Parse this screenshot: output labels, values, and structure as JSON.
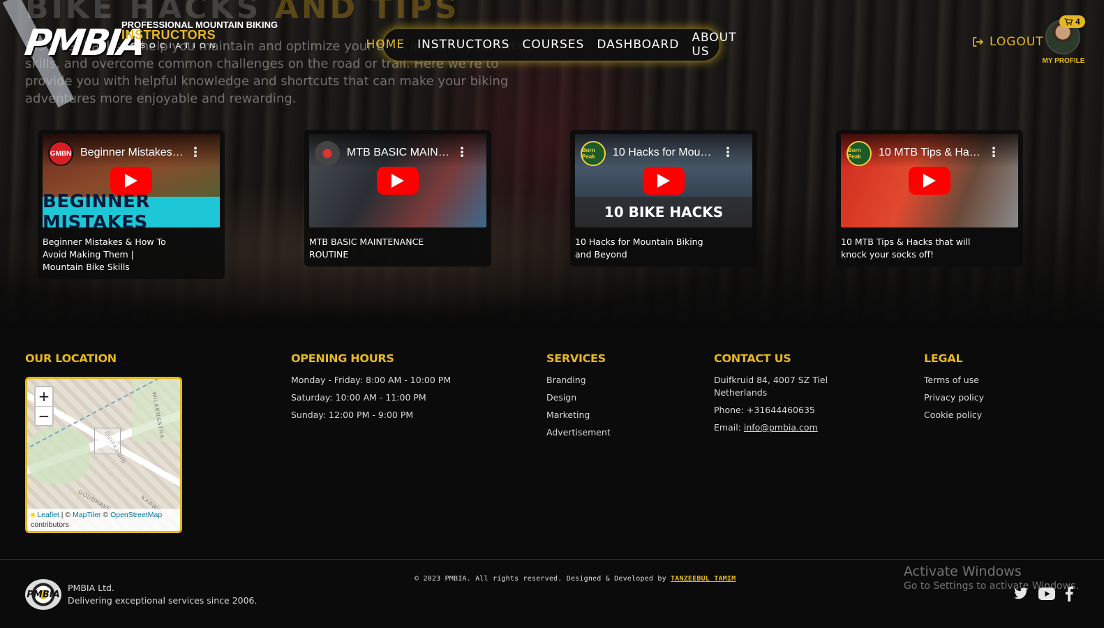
{
  "hero": {
    "title_main": "BIKE HACKS",
    "title_accent": "AND TIPS",
    "description": "Discover hacks to help you maintain and optimize your bike, improve your riding skills, and overcome common challenges on the road or trail. Here we're to provide you with helpful knowledge and shortcuts that can make your biking adventures more enjoyable and rewarding."
  },
  "logo": {
    "mark": "PMBIA",
    "line1": "PROFESSIONAL MOUNTAIN BIKING",
    "line2": "INSTRUCTORS",
    "line3": "ASSOCIATION"
  },
  "nav": {
    "items": [
      {
        "label": "HOME",
        "active": true
      },
      {
        "label": "INSTRUCTORS",
        "active": false
      },
      {
        "label": "COURSES",
        "active": false
      },
      {
        "label": "DASHBOARD",
        "active": false
      },
      {
        "label": "ABOUT US",
        "active": false
      }
    ]
  },
  "header": {
    "logout_label": "LOGOUT",
    "cart_count": "4",
    "profile_label": "MY PROFILE"
  },
  "videos": [
    {
      "channel": "GMBN",
      "thumb_title": "Beginner Mistakes & How To Avoid Making Them",
      "banner": "BEGINNER MISTAKES",
      "caption": "Beginner Mistakes & How To Avoid Making Them | Mountain Bike Skills"
    },
    {
      "channel": "",
      "thumb_title": "MTB BASIC MAINTENANCE ROUTINE",
      "banner": "",
      "caption": "MTB BASIC MAINTENANCE ROUTINE"
    },
    {
      "channel": "Born Peak",
      "thumb_title": "10 Hacks for Mountain Biking and Beyond",
      "banner": "10 BIKE HACKS",
      "caption": "10 Hacks for Mountain Biking and Beyond"
    },
    {
      "channel": "Born Peak",
      "thumb_title": "10 MTB Tips & Hacks that will knock your socks off!",
      "banner": "",
      "caption": "10 MTB Tips & Hacks that will knock your socks off!"
    }
  ],
  "footer": {
    "location": {
      "heading": "OUR LOCATION",
      "zoom_in": "+",
      "zoom_out": "−",
      "attribution_leaflet": "Leaflet",
      "attribution_maptiler": "MapTiler",
      "attribution_osm": "OpenStreetMap",
      "attribution_contributors": "contributors",
      "street1": "WILKENSSTRA",
      "street2": "DUIFKRUID",
      "street3": "GOUDHAVE",
      "street4": "KARWIJ"
    },
    "hours": {
      "heading": "OPENING HOURS",
      "lines": [
        "Monday - Friday: 8:00 AM - 10:00 PM",
        "Saturday: 10:00 AM - 11:00 PM",
        "Sunday: 12:00 PM - 9:00 PM"
      ]
    },
    "services": {
      "heading": "SERVICES",
      "items": [
        "Branding",
        "Design",
        "Marketing",
        "Advertisement"
      ]
    },
    "contact": {
      "heading": "CONTACT US",
      "address": "Duifkruid 84, 4007 SZ Tiel Netherlands",
      "phone": "Phone: +31644460635",
      "email_prefix": "Email:",
      "email": "info@pmbia.com"
    },
    "legal": {
      "heading": "LEGAL",
      "items": [
        "Terms of use",
        "Privacy policy",
        "Cookie policy"
      ]
    },
    "bottom": {
      "logo_text": "PMBIA",
      "company": "PMBIA Ltd.",
      "tagline": "Delivering exceptional services since 2006.",
      "copyright": "© 2023 PMBIA. All rights reserved. Designed & Developed by",
      "developer": "TANZEEBUL TAMIM"
    }
  },
  "os_overlay": {
    "line1": "Activate Windows",
    "line2": "Go to Settings to activate Windows."
  },
  "colors": {
    "accent": "#e6b820",
    "background": "#0b0b0b",
    "youtube_red": "#ff0000"
  },
  "icons": [
    "logout-icon",
    "cart-icon",
    "play-icon",
    "more-vert-icon",
    "twitter-icon",
    "youtube-icon",
    "facebook-icon"
  ]
}
